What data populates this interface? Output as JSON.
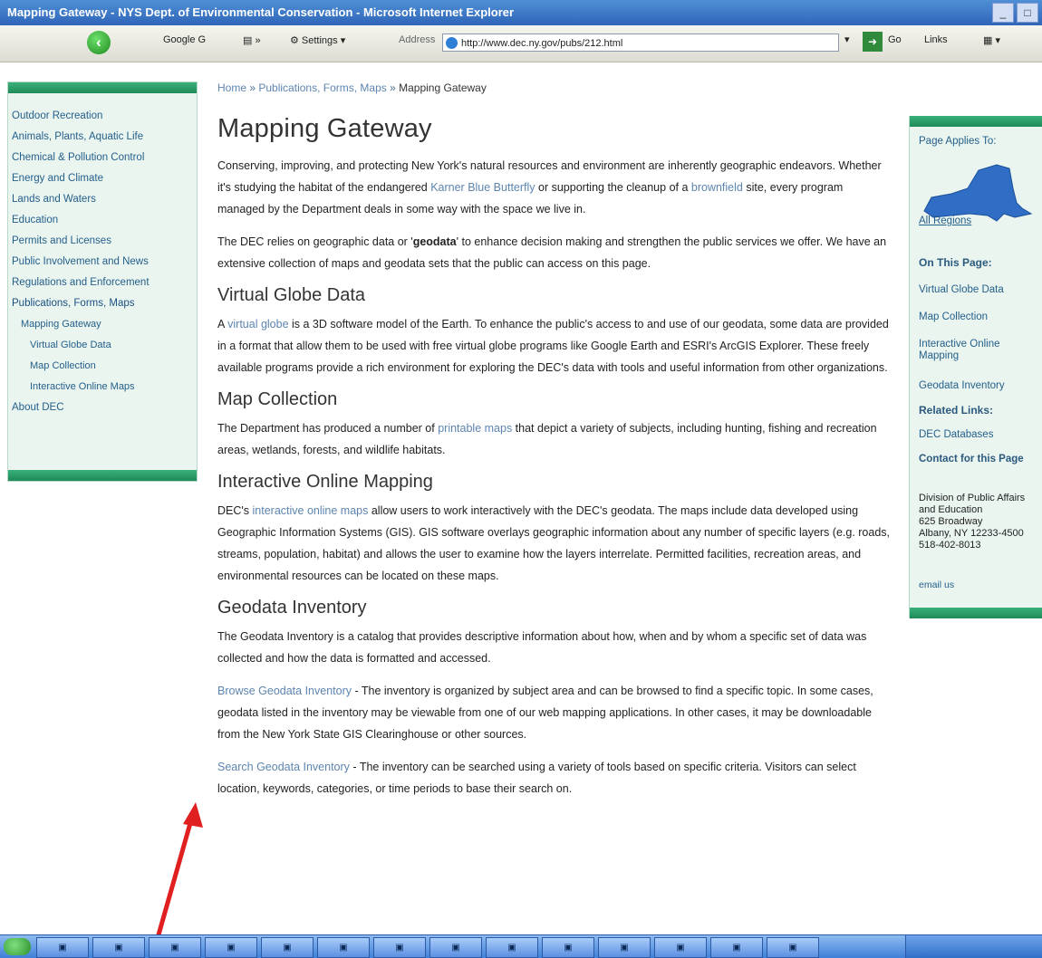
{
  "window": {
    "title": "Mapping Gateway - NYS Dept. of Environmental Conservation - Microsoft Internet Explorer"
  },
  "toolbar": {
    "google_label": "Google G",
    "settings_label": "Settings",
    "address_label": "Address",
    "address_value": "http://www.dec.ny.gov/pubs/212.html",
    "go_label": "Go",
    "links_label": "Links"
  },
  "breadcrumb": {
    "home": "Home",
    "section": "Publications, Forms, Maps",
    "current": "Mapping Gateway"
  },
  "leftnav": {
    "items": [
      "Outdoor Recreation",
      "Animals, Plants, Aquatic Life",
      "Chemical & Pollution Control",
      "Energy and Climate",
      "Lands and Waters",
      "Education",
      "Permits and Licenses",
      "Public Involvement and News",
      "Regulations and Enforcement",
      "Publications, Forms, Maps",
      "Mapping Gateway",
      "Virtual Globe Data",
      "Map Collection",
      "Interactive Online Maps",
      "About DEC"
    ]
  },
  "main": {
    "title": "Mapping Gateway",
    "intro1": {
      "pre": "Conserving, improving, and protecting New York's natural resources and environment are inherently geographic endeavors. Whether it's studying the habitat of the endangered ",
      "link1": "Karner Blue Butterfly",
      "mid": " or supporting the cleanup of a ",
      "link2": "brownfield",
      "post": " site, every program managed by the Department deals in some way with the space we live in."
    },
    "intro2": {
      "pre": "The DEC relies on geographic data or '",
      "bold": "geodata",
      "post": "' to enhance decision making and strengthen the public services we offer. We have an extensive collection of maps and geodata sets that the public can access on this page."
    },
    "sections": {
      "virtual_globe": {
        "heading": "Virtual Globe Data",
        "pre": "A ",
        "link": "virtual globe",
        "post": " is a 3D software model of the Earth. To enhance the public's access to and use of our geodata, some data are provided in a format that allow them to be used with free virtual globe programs like Google Earth and ESRI's ArcGIS Explorer. These freely available programs provide a rich environment for exploring the DEC's data with tools and useful information from other organizations."
      },
      "map_collection": {
        "heading": "Map Collection",
        "pre": "The Department has produced a number of ",
        "link": "printable maps",
        "post": " that depict a variety of subjects, including hunting, fishing and recreation areas, wetlands, forests, and wildlife habitats."
      },
      "interactive": {
        "heading": "Interactive Online Mapping",
        "pre": "DEC's ",
        "link": "interactive online maps",
        "post": " allow users to work interactively with the DEC's geodata. The maps include data developed using Geographic Information Systems (GIS). GIS software overlays geographic information about any number of specific layers (e.g. roads, streams, population, habitat) and allows the user to examine how the layers interrelate. Permitted facilities, recreation areas, and environmental resources can be located on these maps."
      },
      "geodata": {
        "heading": "Geodata Inventory",
        "body": "The Geodata Inventory is a catalog that provides descriptive information about how, when and by whom a specific set of data was collected and how the data is formatted and accessed.",
        "browse_link": "Browse Geodata Inventory",
        "browse_text": " - The inventory is organized by subject area and can be browsed to find a specific topic. In some cases, geodata listed in the inventory may be viewable from one of our web mapping applications. In other cases, it may be downloadable from the New York State GIS Clearinghouse or other sources.",
        "search_link": "Search Geodata Inventory",
        "search_text": " - The inventory can be searched using a variety of tools based on specific criteria. Visitors can select location, keywords, categories, or time periods to base their search on."
      }
    }
  },
  "rightbar": {
    "applies": "Page Applies To:",
    "regions": "All Regions",
    "on_this_page": "On This Page:",
    "links": [
      "Virtual Globe Data",
      "Map Collection",
      "Interactive Online Mapping",
      "Geodata Inventory"
    ],
    "related": "Related Links:",
    "related_link": "DEC Databases",
    "contact": "Contact for this Page",
    "address": "Division of Public Affairs and Education\n625 Broadway\nAlbany, NY 12233-4500\n518-402-8013",
    "email": "email us"
  },
  "colors": {
    "accent_green": "#1e8a58",
    "link_blue": "#5d85b0",
    "annotation_red": "#e02020"
  }
}
